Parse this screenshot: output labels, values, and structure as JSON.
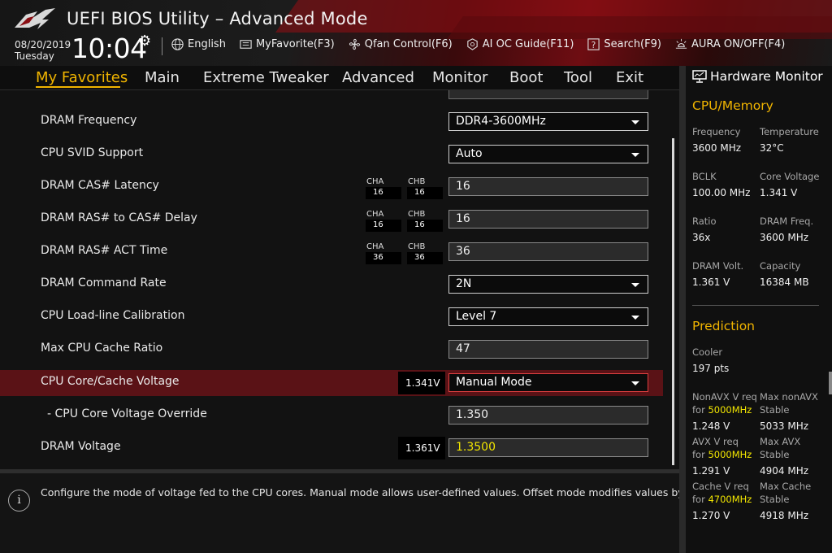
{
  "header": {
    "title": "UEFI BIOS Utility – Advanced Mode",
    "date": "08/20/2019",
    "day": "Tuesday",
    "time": "10:04",
    "toolbar": [
      {
        "label": "English",
        "icon": "globe-icon"
      },
      {
        "label": "MyFavorite(F3)",
        "icon": "favorite-list-icon"
      },
      {
        "label": "Qfan Control(F6)",
        "icon": "fan-icon"
      },
      {
        "label": "AI OC Guide(F11)",
        "icon": "ai-guide-icon"
      },
      {
        "label": "Search(F9)",
        "icon": "help-search-icon"
      },
      {
        "label": "AURA ON/OFF(F4)",
        "icon": "aura-light-icon"
      }
    ]
  },
  "nav": {
    "tabs": [
      "My Favorites",
      "Main",
      "Extreme Tweaker",
      "Advanced",
      "Monitor",
      "Boot",
      "Tool",
      "Exit"
    ],
    "active": "My Favorites"
  },
  "settings": [
    {
      "label": "DRAM Frequency",
      "type": "select",
      "value": "DDR4-3600MHz"
    },
    {
      "label": "CPU SVID Support",
      "type": "select",
      "value": "Auto"
    },
    {
      "label": "DRAM CAS# Latency",
      "type": "input",
      "value": "16",
      "cha": "16",
      "chb": "16"
    },
    {
      "label": "DRAM RAS# to CAS# Delay",
      "type": "input",
      "value": "16",
      "cha": "16",
      "chb": "16"
    },
    {
      "label": "DRAM RAS# ACT Time",
      "type": "input",
      "value": "36",
      "cha": "36",
      "chb": "36"
    },
    {
      "label": "DRAM Command Rate",
      "type": "select",
      "value": "2N"
    },
    {
      "label": "CPU Load-line Calibration",
      "type": "select",
      "value": "Level 7"
    },
    {
      "label": "Max CPU Cache Ratio",
      "type": "input",
      "value": "47"
    },
    {
      "label": "CPU Core/Cache Voltage",
      "type": "select",
      "value": "Manual Mode",
      "voltage": "1.341V",
      "highlighted": true
    },
    {
      "label": "- CPU Core Voltage Override",
      "type": "input",
      "value": "1.350"
    },
    {
      "label": "DRAM Voltage",
      "type": "input",
      "value": "1.3500",
      "voltage": "1.361V"
    }
  ],
  "channel_labels": {
    "a": "CHA",
    "b": "CHB"
  },
  "help_text": "Configure the mode of voltage fed to the CPU cores. Manual mode allows user-defined values. Offset mode modifies values by SVID.",
  "hw_monitor": {
    "title": "Hardware Monitor",
    "cpu_memory": {
      "heading": "CPU/Memory",
      "items": [
        {
          "label": "Frequency",
          "value": "3600 MHz"
        },
        {
          "label": "Temperature",
          "value": "32°C"
        },
        {
          "label": "BCLK",
          "value": "100.00 MHz"
        },
        {
          "label": "Core Voltage",
          "value": "1.341 V"
        },
        {
          "label": "Ratio",
          "value": "36x"
        },
        {
          "label": "DRAM Freq.",
          "value": "3600 MHz"
        },
        {
          "label": "DRAM Volt.",
          "value": "1.361 V"
        },
        {
          "label": "Capacity",
          "value": "16384 MB"
        }
      ]
    },
    "prediction": {
      "heading": "Prediction",
      "cooler_label": "Cooler",
      "cooler_value": "197 pts",
      "rows": [
        {
          "left_label": "NonAVX V req",
          "for_text": "for ",
          "freq": "5000MHz",
          "left_value": "1.248 V",
          "right_label": "Max nonAVX",
          "right_sub": "Stable",
          "right_value": "5033 MHz"
        },
        {
          "left_label": "AVX V req",
          "for_text": "for ",
          "freq": "5000MHz",
          "left_value": "1.291 V",
          "right_label": "Max AVX",
          "right_sub": "Stable",
          "right_value": "4904 MHz"
        },
        {
          "left_label": "Cache V req",
          "for_text": "for ",
          "freq": "4700MHz",
          "left_value": "1.270 V",
          "right_label": "Max Cache",
          "right_sub": "Stable",
          "right_value": "4918 MHz"
        }
      ]
    }
  },
  "colors": {
    "accent": "#f0b400",
    "highlight_row": "#5a1216",
    "yellow_value": "#f2e600"
  }
}
